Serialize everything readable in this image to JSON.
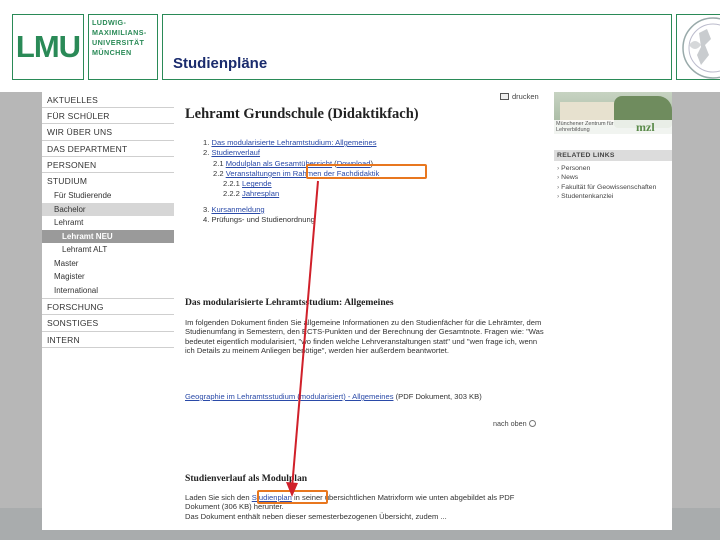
{
  "slide": {
    "title": "Studienpläne",
    "logo": "LMU",
    "university_lines": [
      "LUDWIG-",
      "MAXIMILIANS-",
      "UNIVERSITÄT",
      "MÜNCHEN"
    ]
  },
  "nav": {
    "items": [
      {
        "label": "AKTUELLES"
      },
      {
        "label": "FÜR SCHÜLER"
      },
      {
        "label": "WIR ÜBER UNS"
      },
      {
        "label": "DAS DEPARTMENT"
      },
      {
        "label": "PERSONEN"
      },
      {
        "label": "STUDIUM"
      }
    ],
    "studium_sub": [
      {
        "label": "Für Studierende"
      },
      {
        "label": "Bachelor"
      },
      {
        "label": "Lehramt"
      }
    ],
    "lehramt_sub": [
      {
        "label": "Lehramt NEU"
      },
      {
        "label": "Lehramt ALT"
      }
    ],
    "studium_sub2": [
      {
        "label": "Master"
      },
      {
        "label": "Magister"
      },
      {
        "label": "International"
      }
    ],
    "bottom_items": [
      {
        "label": "FORSCHUNG"
      },
      {
        "label": "SONSTIGES"
      },
      {
        "label": "INTERN"
      }
    ]
  },
  "toolbar": {
    "print_label": "drucken"
  },
  "main": {
    "heading": "Lehramt Grundschule (Didaktikfach)",
    "toc": {
      "item1_num": "1.",
      "item1_label": "Das modularisierte Lehramtstudium: Allgemeines",
      "item2_num": "2.",
      "item2_label": "Studienverlauf",
      "item21_num": "2.1",
      "item21_label": "Modulplan als Gesamtübersicht",
      "item21_download": "Download",
      "item22_num": "2.2",
      "item22_label": "Veranstaltungen im Rahmen der Fachdidaktik",
      "item221_num": "2.2.1",
      "item221_label": "Legende",
      "item222_num": "2.2.2",
      "item222_label": "Jahresplan",
      "item3_num": "3.",
      "item3_label": "Kursanmeldung",
      "item4_num": "4.",
      "item4_label": "Prüfungs- und Studienordnung"
    },
    "section1_title": "Das modularisierte Lehramtsstudium: Allgemeines",
    "section1_text": "Im folgenden Dokument finden Sie allgemeine Informationen zu den Studienfächer für die Lehrämter, dem Studienumfang in Semestern, den ECTS-Punkten und der Berechnung der Gesamtnote. Fragen wie: \"Was bedeutet eigentlich modularisiert, \"wo finden welche Lehrveranstaltungen statt\" und \"wen frage ich, wenn ich Details zu meinem Anliegen benötige\", werden hier außerdem beantwortet.",
    "doc_link": "Geographie im Lehramtsstudium (modularisiert) - Allgemeines",
    "doc_meta": "(PDF Dokument, 303 KB)",
    "back_to_top": "nach oben",
    "section2_title": "Studienverlauf als Modulplan",
    "section2_text_before": "Laden Sie sich den",
    "section2_link": "Studienplan",
    "section2_link_suffix": "in",
    "section2_text_after": "seiner übersichtlichen Matrixform wie unten abgebildet als PDF Dokument (306 KB) herunter.",
    "section2_text_line3": "Das Dokument enthält neben dieser semesterbezogenen Übersicht, zudem ..."
  },
  "side": {
    "banner_caption": "Münchener Zentrum für Lehrerbildung",
    "banner_logo": "mzl",
    "related_title": "RELATED LINKS",
    "related_links": [
      "Personen",
      "News",
      "Fakultät für Geowissenschaften",
      "Studentenkanzlei"
    ]
  },
  "colors": {
    "lmu_green": "#2a8a57",
    "title_blue": "#1a2b6d",
    "highlight_orange": "#e8771f",
    "arrow_red": "#d0202a",
    "link_blue": "#2a4aa8"
  }
}
